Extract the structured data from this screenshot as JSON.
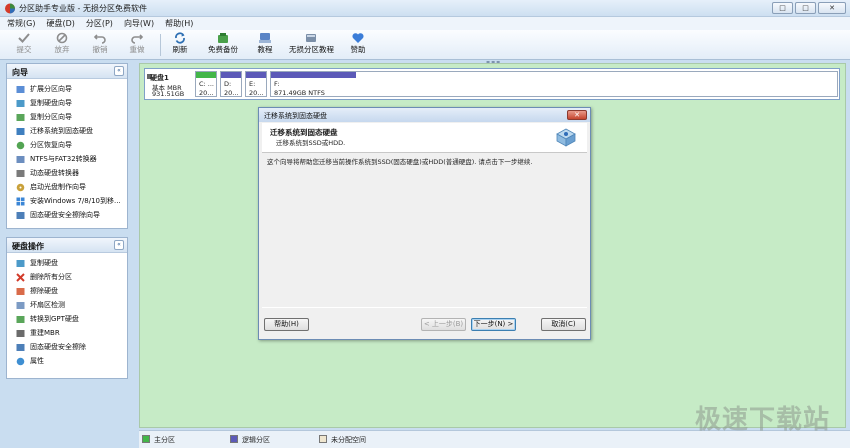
{
  "window": {
    "title": "分区助手专业版 - 无损分区免费软件",
    "buttons": [
      "□",
      "□",
      "✕"
    ]
  },
  "menu": [
    "常规(G)",
    "硬盘(D)",
    "分区(P)",
    "向导(W)",
    "帮助(H)"
  ],
  "toolbar": {
    "commit": "提交",
    "discard": "放弃",
    "undo": "撤销",
    "redo": "重做",
    "refresh": "刷新",
    "backup": "免费备份",
    "tutorial": "教程",
    "lossless_tutorial": "无损分区教程",
    "donate": "赞助"
  },
  "wizard_panel": {
    "title": "向导",
    "collapse": "«",
    "items": [
      "扩展分区向导",
      "复制硬盘向导",
      "复制分区向导",
      "迁移系统到固态硬盘",
      "分区恢复向导",
      "NTFS与FAT32转换器",
      "动态硬盘转换器",
      "启动光盘制作向导",
      "安装Windows 7/8/10到移...",
      "固态硬盘安全擦除向导"
    ]
  },
  "disk_panel": {
    "title": "硬盘操作",
    "collapse": "«",
    "items": [
      "复制硬盘",
      "删除所有分区",
      "擦除硬盘",
      "坏扇区检测",
      "转换到GPT硬盘",
      "重建MBR",
      "固态硬盘安全擦除",
      "属性"
    ]
  },
  "disk": {
    "name": "硬盘1",
    "type": "基本 MBR",
    "size": "931.51GB",
    "partitions": [
      {
        "label": "C: ...",
        "size": "20...",
        "fill": 1.0,
        "kind": "primary"
      },
      {
        "label": "D:",
        "size": "20...",
        "fill": 1.0,
        "kind": "logical"
      },
      {
        "label": "E:",
        "size": "20...",
        "fill": 1.0,
        "kind": "logical"
      },
      {
        "label": "F:",
        "size": "871.49GB NTFS",
        "fill": 0.15,
        "kind": "logical"
      }
    ]
  },
  "dialog": {
    "title": "迁移系统到固态硬盘",
    "close": "✕",
    "header_title": "迁移系统到固态硬盘",
    "header_subtitle": "迁移系统到SSD或HDD.",
    "body": "这个向导将帮助您迁移当前操作系统到SSD(固态硬盘)或HDD(普通硬盘). 请点击下一步继续.",
    "help": "帮助(H)",
    "back": "< 上一步(B)",
    "next": "下一步(N) >",
    "cancel": "取消(C)"
  },
  "legend": {
    "primary": "主分区",
    "logical": "逻辑分区",
    "unallocated": "未分配空间"
  },
  "colors": {
    "primary": "#43b649",
    "logical": "#5c5ab8",
    "unallocated": "#efe6cf",
    "disk_area": "#c6ebc6"
  },
  "watermark": "极速下载站"
}
